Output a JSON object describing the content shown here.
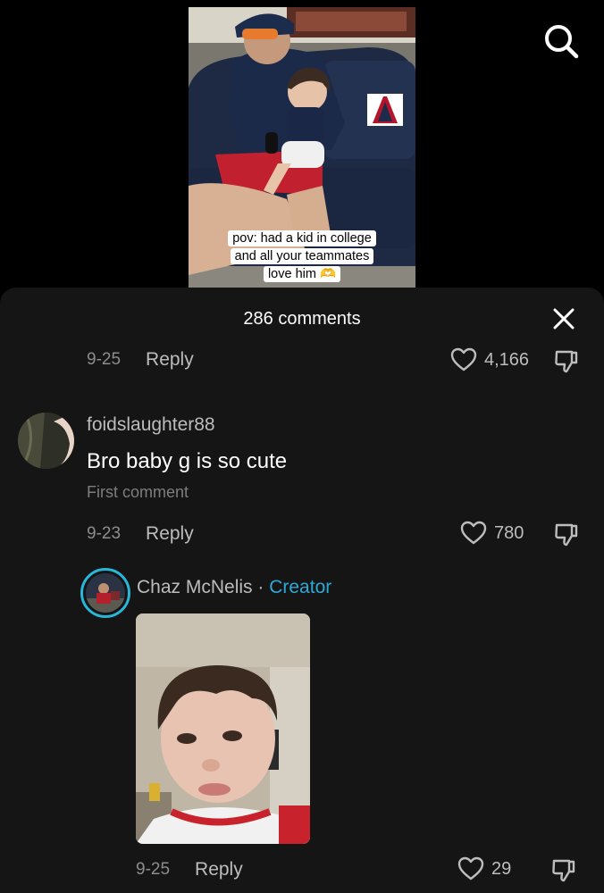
{
  "video": {
    "caption_line1": "pov: had a kid in college",
    "caption_line2": "and all your teammates",
    "caption_line3": "love him 🫶"
  },
  "header": {
    "search_icon": "search-icon"
  },
  "comments_panel": {
    "title": "286 comments",
    "close_icon": "close-icon"
  },
  "comments": [
    {
      "date": "9-25",
      "reply_label": "Reply",
      "likes": "4,166"
    },
    {
      "username": "foidslaughter88",
      "text": "Bro baby g is so cute",
      "label": "First comment",
      "date": "9-23",
      "reply_label": "Reply",
      "likes": "780"
    }
  ],
  "creator_reply": {
    "username": "Chaz McNelis",
    "separator": "·",
    "badge": "Creator",
    "date": "9-25",
    "reply_label": "Reply",
    "likes": "29"
  },
  "colors": {
    "sheet_bg": "#151515",
    "creator_accent": "#2ea8d8"
  }
}
